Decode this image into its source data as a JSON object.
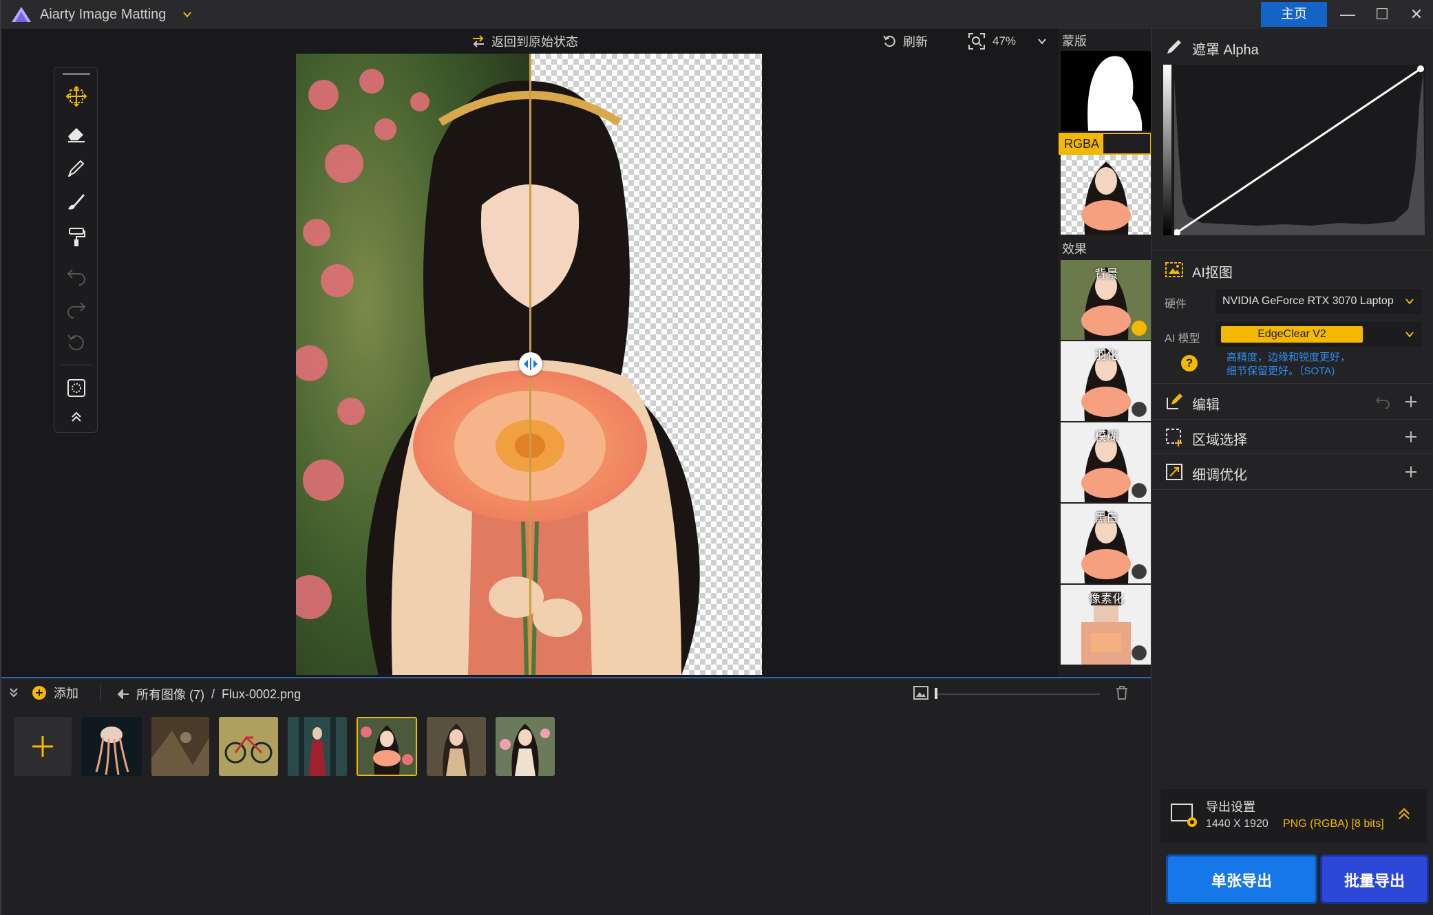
{
  "app": {
    "title": "Aiarty Image Matting",
    "home": "主页"
  },
  "window_controls": [
    "—",
    "☐",
    "✕"
  ],
  "canvas_toolbar": {
    "revert": "返回到原始状态",
    "refresh": "刷新",
    "zoom": "47%"
  },
  "tools": [
    "select-move",
    "eraser",
    "pen",
    "brush",
    "roller",
    "undo",
    "redo",
    "reset",
    "region",
    "collapse"
  ],
  "strip": {
    "mask_label": "蒙版",
    "rgba_label": "RGBA",
    "effect_label": "效果",
    "effects": [
      "背景",
      "羽化",
      "模糊",
      "黑白",
      "像素化"
    ]
  },
  "right": {
    "alpha_title": "遮罩 Alpha",
    "ai_title": "AI抠图",
    "hardware_label": "硬件",
    "hardware_value": "NVIDIA GeForce RTX 3070 Laptop",
    "model_label": "AI 模型",
    "model_value": "EdgeClear  V2",
    "model_desc_1": "高精度，边缘和锐度更好，",
    "model_desc_2": "细节保留更好。（SOTA)",
    "help": "?",
    "edit_title": "编辑",
    "region_title": "区域选择",
    "refine_title": "细调优化",
    "export_title": "导出设置",
    "export_size": "1440 X 1920",
    "export_format": "PNG (RGBA) [8 bits]",
    "export_single": "单张导出",
    "export_batch": "批量导出"
  },
  "bottom": {
    "add": "添加",
    "crumb_all": "所有图像 (7)",
    "crumb_sep": "/",
    "crumb_file": "Flux-0002.png",
    "thumbnails": [
      "jellyfish",
      "forest-bird",
      "bicycle",
      "red-dress-forest",
      "flower-girl",
      "girl-portrait-2",
      "girl-portrait-3"
    ],
    "selected_index": 4
  },
  "colors": {
    "accent": "#f5b800",
    "blue": "#1677e8",
    "batch": "#2c48d8"
  }
}
